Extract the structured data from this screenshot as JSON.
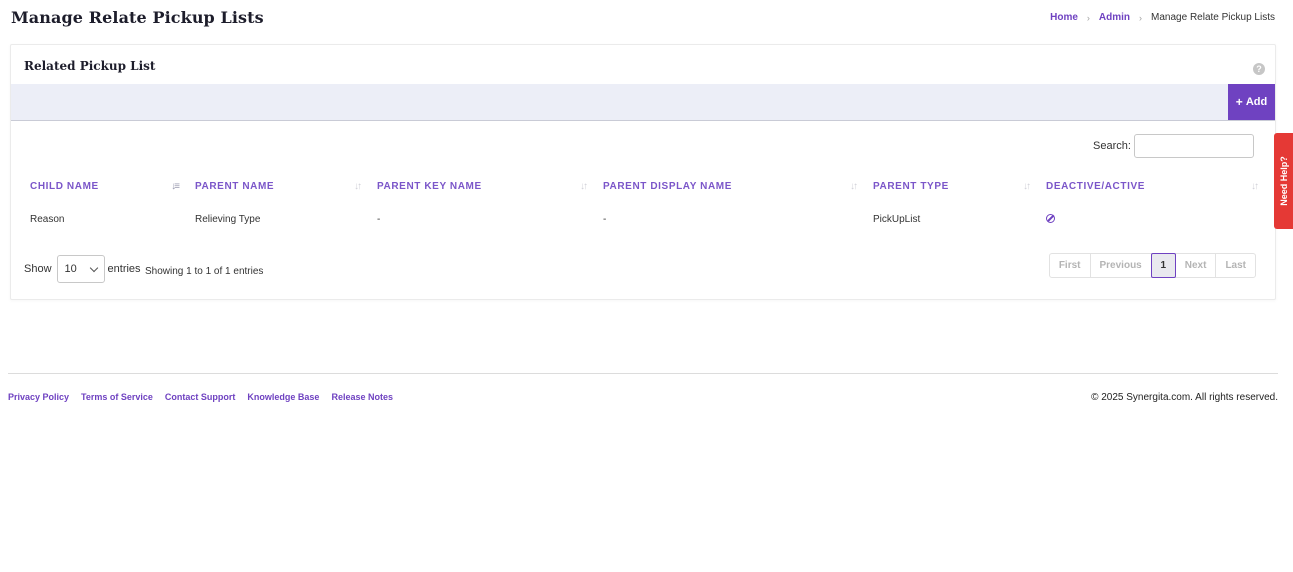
{
  "page": {
    "title": "Manage Relate Pickup Lists",
    "breadcrumb": {
      "home": "Home",
      "admin": "Admin",
      "current": "Manage Relate Pickup Lists"
    }
  },
  "card": {
    "title": "Related Pickup List",
    "add_label": "Add",
    "search_label": "Search:",
    "search_value": ""
  },
  "table": {
    "columns": [
      "CHILD NAME",
      "PARENT NAME",
      "PARENT KEY NAME",
      "PARENT DISPLAY NAME",
      "PARENT TYPE",
      "DEACTIVE/ACTIVE"
    ],
    "rows": [
      {
        "child_name": "Reason",
        "parent_name": "Relieving Type",
        "parent_key_name": "-",
        "parent_display_name": "-",
        "parent_type": "PickUpList",
        "status_icon": "deactivate-icon"
      }
    ]
  },
  "length_menu": {
    "show": "Show",
    "value": "10",
    "entries": "entries"
  },
  "info": "Showing 1 to 1 of 1 entries",
  "pagination": {
    "first": "First",
    "previous": "Previous",
    "current": "1",
    "next": "Next",
    "last": "Last"
  },
  "footer": {
    "links": [
      "Privacy Policy",
      "Terms of Service",
      "Contact Support",
      "Knowledge Base",
      "Release Notes"
    ],
    "copyright": "© 2025 Synergita.com. All rights reserved."
  },
  "need_help": "Need Help?",
  "colors": {
    "accent": "#6f42c1",
    "toolbar_bg": "#eceef7",
    "help_tab": "#e53935"
  }
}
